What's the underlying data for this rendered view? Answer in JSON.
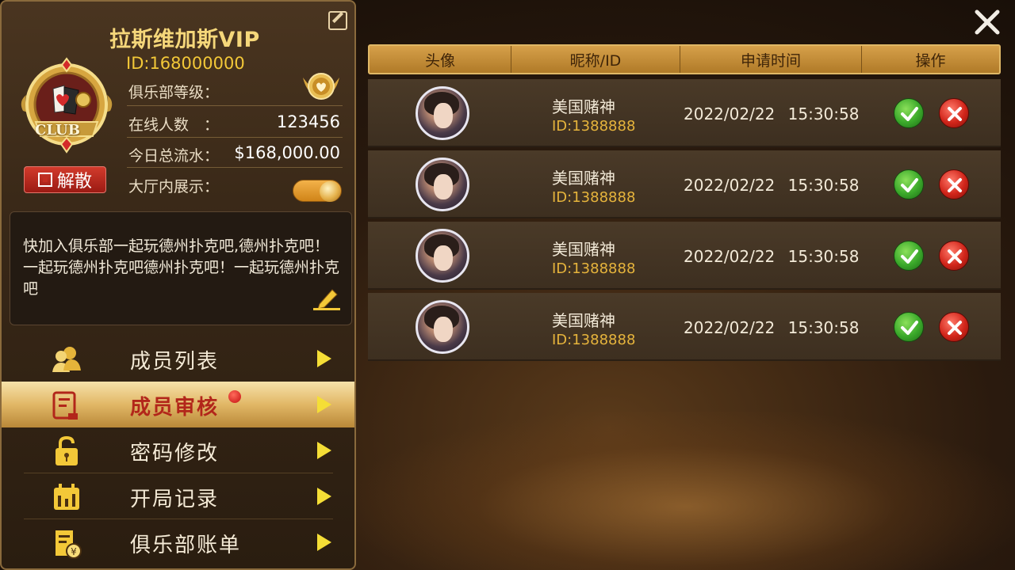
{
  "club": {
    "name": "拉斯维加斯VIP",
    "id": "ID:168000000",
    "level_label": "俱乐部等级：",
    "online_label": "在线人数　：",
    "online_value": "123456",
    "flow_label": "今日总流水：",
    "flow_value": "$168,000.00",
    "display_label": "大厅内展示：",
    "display_on": true,
    "dissolve_label": "解散",
    "notice": "快加入俱乐部一起玩德州扑克吧,德州扑克吧！一起玩德州扑克吧德州扑克吧！一起玩德州扑克吧"
  },
  "menu": [
    {
      "label": "成员列表",
      "icon": "members-icon",
      "active": false
    },
    {
      "label": "成员审核",
      "icon": "review-icon",
      "active": true,
      "badge": true
    },
    {
      "label": "密码修改",
      "icon": "lock-icon",
      "active": false
    },
    {
      "label": "开局记录",
      "icon": "calendar-icon",
      "active": false
    },
    {
      "label": "俱乐部账单",
      "icon": "bill-icon",
      "active": false
    }
  ],
  "table": {
    "headers": [
      "头像",
      "昵称/ID",
      "申请时间",
      "操作"
    ],
    "rows": [
      {
        "nickname": "美国赌神",
        "id": "ID:1388888",
        "time": "2022/02/22 15:30:58"
      },
      {
        "nickname": "美国赌神",
        "id": "ID:1388888",
        "time": "2022/02/22 15:30:58"
      },
      {
        "nickname": "美国赌神",
        "id": "ID:1388888",
        "time": "2022/02/22 15:30:58"
      },
      {
        "nickname": "美国赌神",
        "id": "ID:1388888",
        "time": "2022/02/22 15:30:58"
      }
    ]
  },
  "colors": {
    "accent_gold": "#f3c838",
    "active_red": "#b2261a",
    "approve_green": "#3aa82a",
    "reject_red": "#d1251a"
  }
}
